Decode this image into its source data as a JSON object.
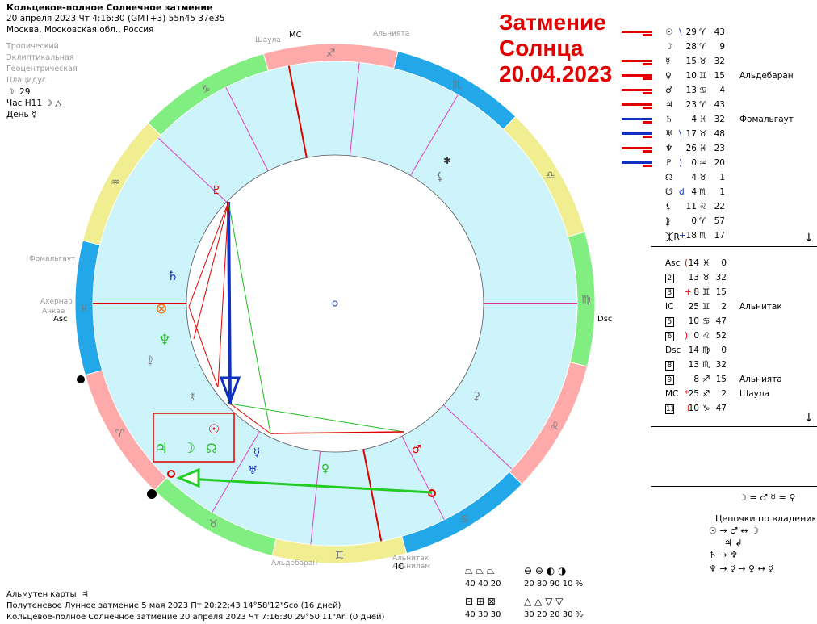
{
  "header": {
    "title": "Кольцевое-полное Солнечное затмение",
    "date_line": "20 апреля 2023  Чт   4:16:30 (GMT+3) 55n45  37e35",
    "location": "Москва, Московская обл., Россия",
    "settings": [
      "Тропический",
      "Эклиптикальная",
      "Геоцентрическая",
      "Плацидус"
    ],
    "moon_day": "29",
    "hour_line": "Час H11",
    "day_line": "День"
  },
  "eclipse_title": [
    "Затмение",
    "Солнца",
    "20.04.2023"
  ],
  "planets": [
    {
      "bars": "red",
      "sym": "☉",
      "sep": "\\",
      "deg": "29",
      "sign": "♈",
      "min": "43",
      "star": ""
    },
    {
      "bars": "none",
      "sym": "☽",
      "sep": "",
      "deg": "28",
      "sign": "♈",
      "min": "9",
      "star": ""
    },
    {
      "bars": "red",
      "sym": "☿",
      "sep": "",
      "deg": "15",
      "sign": "♉",
      "min": "32",
      "star": ""
    },
    {
      "bars": "red",
      "sym": "♀",
      "sep": "",
      "deg": "10",
      "sign": "♊",
      "min": "15",
      "star": "Альдебаран"
    },
    {
      "bars": "red",
      "sym": "♂",
      "sep": "",
      "deg": "13",
      "sign": "♋",
      "min": "4",
      "star": ""
    },
    {
      "bars": "red",
      "sym": "♃",
      "sep": "",
      "deg": "23",
      "sign": "♈",
      "min": "43",
      "star": ""
    },
    {
      "bars": "blue",
      "sym": "♄",
      "sep": "",
      "deg": "4",
      "sign": "♓",
      "min": "32",
      "star": "Фомальгаут"
    },
    {
      "bars": "blue",
      "sym": "♅",
      "sep": "\\",
      "deg": "17",
      "sign": "♉",
      "min": "48",
      "star": ""
    },
    {
      "bars": "red",
      "sym": "♆",
      "sep": "",
      "deg": "26",
      "sign": "♓",
      "min": "23",
      "star": ""
    },
    {
      "bars": "blue",
      "sym": "♇",
      "sep": ")",
      "deg": "0",
      "sign": "♒",
      "min": "20",
      "star": ""
    },
    {
      "bars": "none",
      "sym": "☊",
      "sep": "",
      "deg": "4",
      "sign": "♉",
      "min": "1",
      "star": ""
    },
    {
      "bars": "none",
      "sym": "☋",
      "sep": "d",
      "deg": "4",
      "sign": "♏",
      "min": "1",
      "star": ""
    },
    {
      "bars": "none",
      "sym": "⚸",
      "sep": "",
      "deg": "11",
      "sign": "♌",
      "min": "22",
      "star": ""
    },
    {
      "bars": "none",
      "sym": "⯝",
      "sep": "",
      "deg": "0",
      "sign": "♈",
      "min": "57",
      "star": ""
    },
    {
      "bars": "none",
      "sym": "⯰R",
      "sep": "+",
      "deg": "18",
      "sign": "♏",
      "min": "17",
      "star": ""
    }
  ],
  "houses": [
    {
      "label": "Asc",
      "sep": "(",
      "deg": "14",
      "sign": "♓",
      "min": "0",
      "star": ""
    },
    {
      "label": "2",
      "sep": "",
      "deg": "13",
      "sign": "♉",
      "min": "32",
      "star": ""
    },
    {
      "label": "3",
      "sep": "+",
      "deg": "8",
      "sign": "♊",
      "min": "15",
      "star": ""
    },
    {
      "label": "IC",
      "sep": "",
      "deg": "25",
      "sign": "♊",
      "min": "2",
      "star": "Альнитак"
    },
    {
      "label": "5",
      "sep": "",
      "deg": "10",
      "sign": "♋",
      "min": "47",
      "star": ""
    },
    {
      "label": "6",
      "sep": ")",
      "deg": "0",
      "sign": "♌",
      "min": "52",
      "star": ""
    },
    {
      "label": "Dsc",
      "sep": "",
      "deg": "14",
      "sign": "♍",
      "min": "0",
      "star": ""
    },
    {
      "label": "8",
      "sep": "",
      "deg": "13",
      "sign": "♏",
      "min": "32",
      "star": ""
    },
    {
      "label": "9",
      "sep": "",
      "deg": "8",
      "sign": "♐",
      "min": "15",
      "star": "Альнията"
    },
    {
      "label": "MC",
      "sep": "*",
      "deg": "25",
      "sign": "♐",
      "min": "2",
      "star": "Шаула"
    },
    {
      "label": "11",
      "sep": "+",
      "deg": "10",
      "sign": "♑",
      "min": "47",
      "star": ""
    }
  ],
  "reception": "☽ = ♂  ☿ = ♀",
  "chains_title": "Цепочки по владению",
  "chains": [
    "☉ → ♂ ↔ ☽",
    "♃ ↲",
    "♄ → ♆",
    "♆ → ☿ → ♀ ↔ ☿"
  ],
  "stats": {
    "group1_vals": "40  40  20",
    "group2_vals": "20  80  90  10 %",
    "group3_vals": "40  30  30",
    "group4_vals": "30  20  20  30 %"
  },
  "footer": {
    "almuten": "Альмутен карты",
    "lunar": "Полутеневое Лунное затмение 5 мая 2023 Пт 20:22:43 14°58'12\"Sco (16 дней)",
    "solar": "Кольцевое-полное Солнечное затмение 20 апреля 2023 Чт  7:16:30 29°50'11\"Ari (0 дней)"
  },
  "wheel_labels": {
    "shaula": "Шаула",
    "alniyat": "Альнията",
    "fomalhaut": "Фомальгаут",
    "achernar": "Ахернар",
    "ankaa": "Анкаа",
    "aldebaran": "Альдебаран",
    "alnitak": "Альнитак",
    "alnilam": "Альнилам",
    "asc": "Asc",
    "dsc": "Dsc",
    "mc": "MC",
    "ic": "IC"
  },
  "colors": {
    "red": "#e00000",
    "blue": "#1030c0",
    "fire": "#ffaaaa",
    "earth": "#80ee80",
    "air": "#f0ee90",
    "water": "#22a8e8",
    "inner": "#cdf3fb"
  }
}
